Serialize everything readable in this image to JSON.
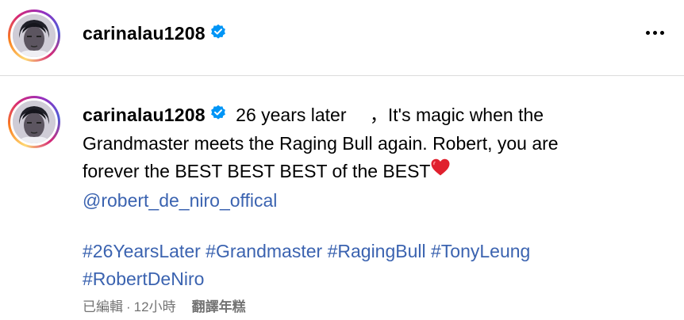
{
  "header": {
    "username": "carinalau1208",
    "verified_icon": "verified-badge-icon",
    "more_icon": "more-horizontal-icon"
  },
  "caption": {
    "username": "carinalau1208",
    "line1_text": "26 years later 　，It's magic when the",
    "line2_text": "Grandmaster meets the Raging Bull again. Robert, you are",
    "line3_text": "forever the BEST BEST BEST of the BEST",
    "heart_icon": "red-heart-emoji",
    "mention": "@robert_de_niro_offical",
    "hashtags": [
      "#26YearsLater",
      "#Grandmaster",
      "#RagingBull",
      "#TonyLeung",
      "#RobertDeNiro"
    ]
  },
  "meta": {
    "edited": "已編輯",
    "separator": "·",
    "time": "12小時",
    "translate": "翻譯年糕"
  },
  "colors": {
    "link": "#3b63b0",
    "verified": "#0095f6",
    "heart": "#e0202e",
    "meta": "#737373",
    "divider": "#dbdbdb"
  }
}
